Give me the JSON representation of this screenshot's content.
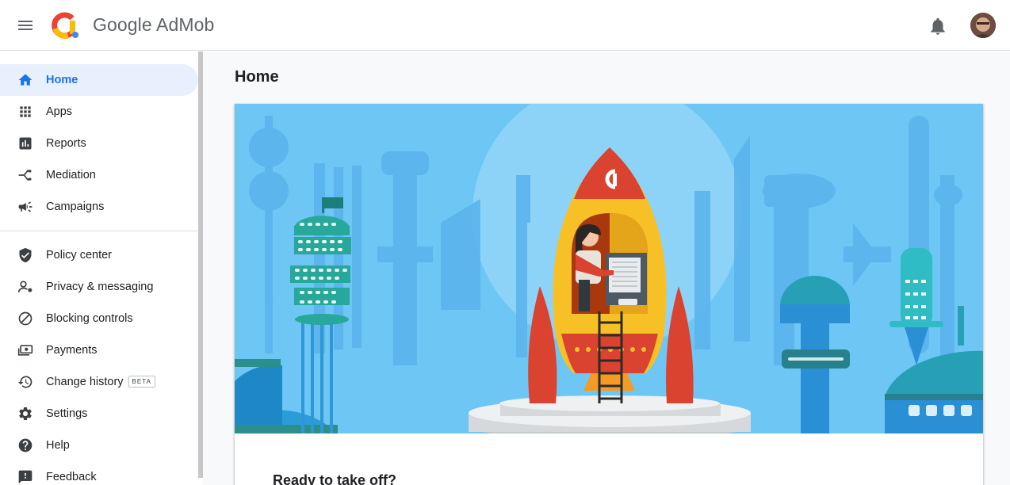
{
  "header": {
    "brand_google": "Google",
    "brand_product": "AdMob"
  },
  "sidebar": {
    "items": [
      {
        "label": "Home",
        "icon": "home-icon",
        "active": true
      },
      {
        "label": "Apps",
        "icon": "apps-grid-icon"
      },
      {
        "label": "Reports",
        "icon": "bar-chart-icon"
      },
      {
        "label": "Mediation",
        "icon": "mediation-icon"
      },
      {
        "label": "Campaigns",
        "icon": "megaphone-icon"
      },
      {
        "label": "Policy center",
        "icon": "shield-icon"
      },
      {
        "label": "Privacy & messaging",
        "icon": "person-settings-icon"
      },
      {
        "label": "Blocking controls",
        "icon": "block-icon"
      },
      {
        "label": "Payments",
        "icon": "payments-icon"
      },
      {
        "label": "Change history",
        "icon": "history-icon",
        "badge": "BETA"
      },
      {
        "label": "Settings",
        "icon": "gear-icon"
      },
      {
        "label": "Help",
        "icon": "help-icon"
      },
      {
        "label": "Feedback",
        "icon": "feedback-icon"
      }
    ]
  },
  "main": {
    "page_title": "Home",
    "card": {
      "heading": "Ready to take off?"
    }
  },
  "colors": {
    "accent": "#1a73e8",
    "active_bg": "#e8f0fe",
    "hero_sky": "#6ec6f5",
    "rocket_yellow": "#f6c026",
    "rocket_red": "#d9432f"
  }
}
